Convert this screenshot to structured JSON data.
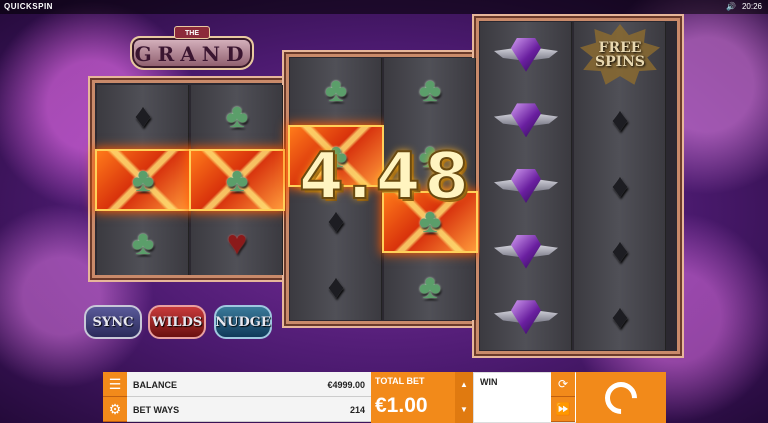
{
  "topbar": {
    "brand": "QUICKSPIN",
    "volume_icon": "speaker-icon",
    "time": "20:26"
  },
  "logo": {
    "the": "THE",
    "word": "GRAND"
  },
  "reels": [
    {
      "cells": [
        "diamond",
        "club",
        "club"
      ],
      "win": [
        false,
        true,
        false
      ]
    },
    {
      "cells": [
        "club",
        "club",
        "heart"
      ],
      "win": [
        false,
        true,
        false
      ]
    },
    {
      "cells": [
        "club",
        "club",
        "diamond",
        "diamond"
      ],
      "win": [
        false,
        true,
        false,
        false
      ]
    },
    {
      "cells": [
        "club",
        "club",
        "club",
        "club"
      ],
      "win": [
        false,
        false,
        true,
        false
      ]
    },
    {
      "cells": [
        "gem",
        "gem",
        "gem",
        "gem",
        "gem"
      ],
      "win": [
        false,
        false,
        false,
        false,
        false
      ]
    },
    {
      "cells": [
        "freespins",
        "diamond",
        "diamond",
        "diamond",
        "diamond"
      ],
      "win": [
        false,
        false,
        false,
        false,
        false
      ]
    }
  ],
  "free_spins_label": "FREE SPINS",
  "win_amount": "4.48",
  "features": {
    "sync": "SYNC",
    "wilds": "WILDS",
    "nudge": "NUDGE"
  },
  "bottom": {
    "balance_label": "BALANCE",
    "balance_value": "€4999.00",
    "betways_label": "BET WAYS",
    "betways_value": "214",
    "totalbet_label": "TOTAL BET",
    "totalbet_value": "€1.00",
    "win_label": "WIN",
    "win_value": ""
  }
}
